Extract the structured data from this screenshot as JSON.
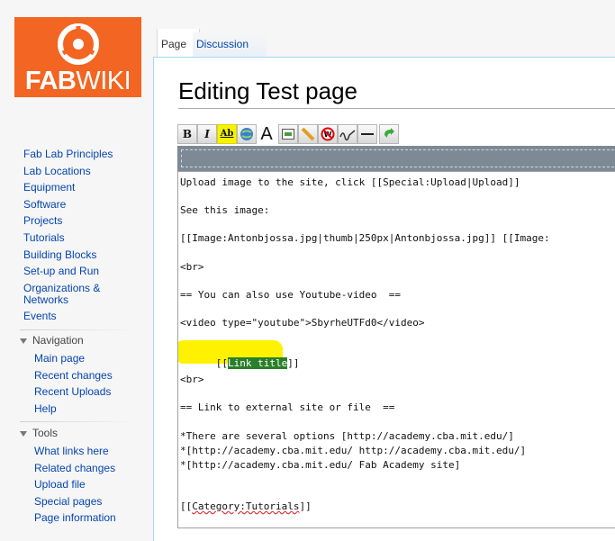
{
  "logo": {
    "fab": "FAB",
    "wiki": "WIKI"
  },
  "sidebar": {
    "main_links": [
      "Fab Lab Principles",
      "Lab Locations",
      "Equipment",
      "Software",
      "Projects",
      "Tutorials",
      "Building Blocks",
      "Set-up and Run",
      "Organizations &",
      "Networks",
      "Events"
    ],
    "navigation": {
      "heading": "Navigation",
      "links": [
        "Main page",
        "Recent changes",
        "Recent Uploads",
        "Help"
      ]
    },
    "tools": {
      "heading": "Tools",
      "links": [
        "What links here",
        "Related changes",
        "Upload file",
        "Special pages",
        "Page information"
      ]
    }
  },
  "tabs": {
    "page": "Page",
    "discussion": "Discussion"
  },
  "page_title": "Editing Test page",
  "toolbar": {
    "bold": "B",
    "italic": "I",
    "link": "Ab",
    "font": "A"
  },
  "editor": {
    "lines": [
      "Upload image to the site, click [[Special:Upload|Upload]]",
      "See this image:",
      "[[Image:Antonbjossa.jpg|thumb|250px|Antonbjossa.jpg]] [[Image:",
      "<br>",
      "== You can also use Youtube-video  ==",
      "<video type=\"youtube\">SbyrheUTFd0</video>",
      "[[Link title]]",
      "<br>",
      "== Link to external site or file  ==",
      "*There are several options [http://academy.cba.mit.edu/]",
      "*[http://academy.cba.mit.edu/ http://academy.cba.mit.edu/]",
      "*[http://academy.cba.mit.edu/ Fab Academy site]",
      "[[Category:Tutorials]]"
    ],
    "link_prefix": "[[",
    "link_selected": "Link title",
    "link_suffix": "]]",
    "cat_prefix": "[[",
    "cat_underlined": "Category:Tutorials",
    "cat_suffix": "]]"
  }
}
